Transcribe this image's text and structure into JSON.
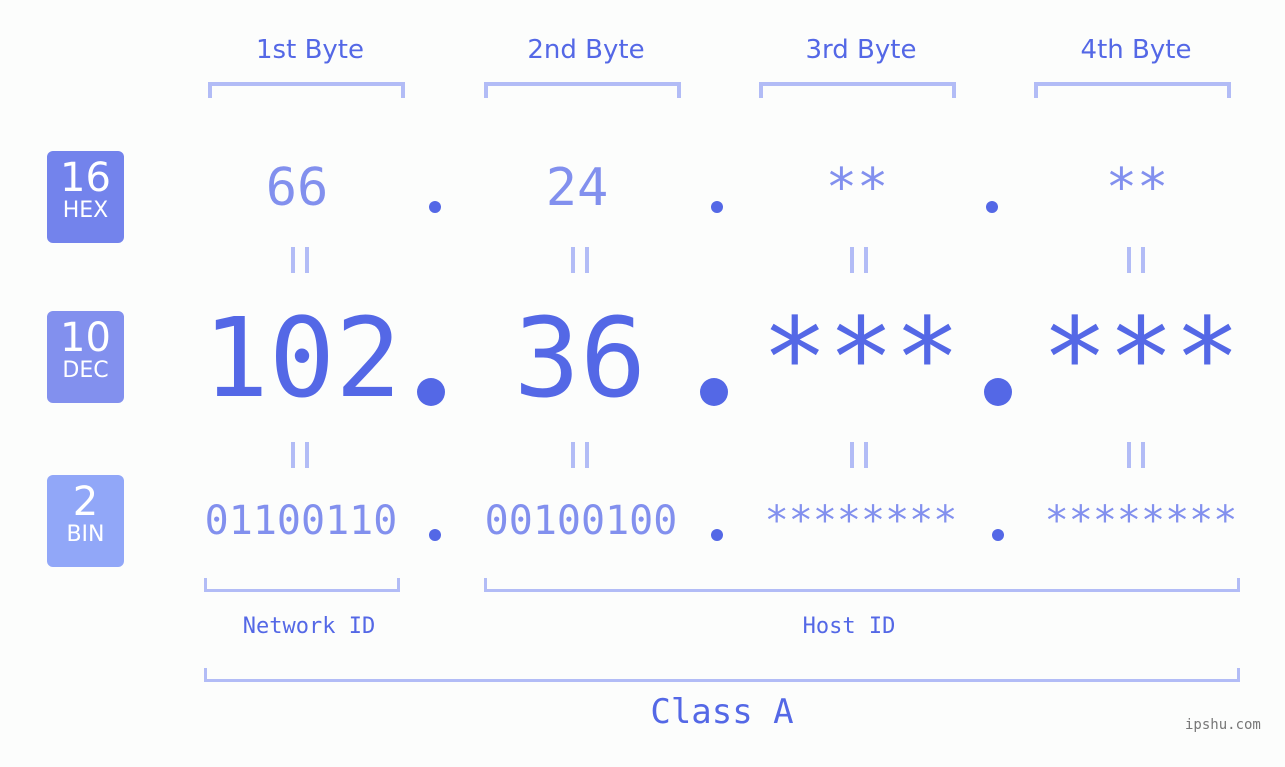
{
  "headers": [
    "1st Byte",
    "2nd Byte",
    "3rd Byte",
    "4th Byte"
  ],
  "rows": {
    "hex": {
      "base": "16",
      "label": "HEX",
      "color": "#7383ec",
      "values": [
        "66",
        "24",
        "**",
        "**"
      ]
    },
    "dec": {
      "base": "10",
      "label": "DEC",
      "color": "#8290ee",
      "values": [
        "102",
        "36",
        "***",
        "***"
      ]
    },
    "bin": {
      "base": "2",
      "label": "BIN",
      "color": "#91a7f8",
      "values": [
        "01100110",
        "00100100",
        "********",
        "********"
      ]
    }
  },
  "separator": ".",
  "segments": {
    "network": "Network ID",
    "host": "Host ID"
  },
  "class_label": "Class A",
  "watermark": "ipshu.com",
  "colors": {
    "accent": "#5468e6",
    "light": "#8290ee",
    "bracket": "#b2bcf6"
  }
}
